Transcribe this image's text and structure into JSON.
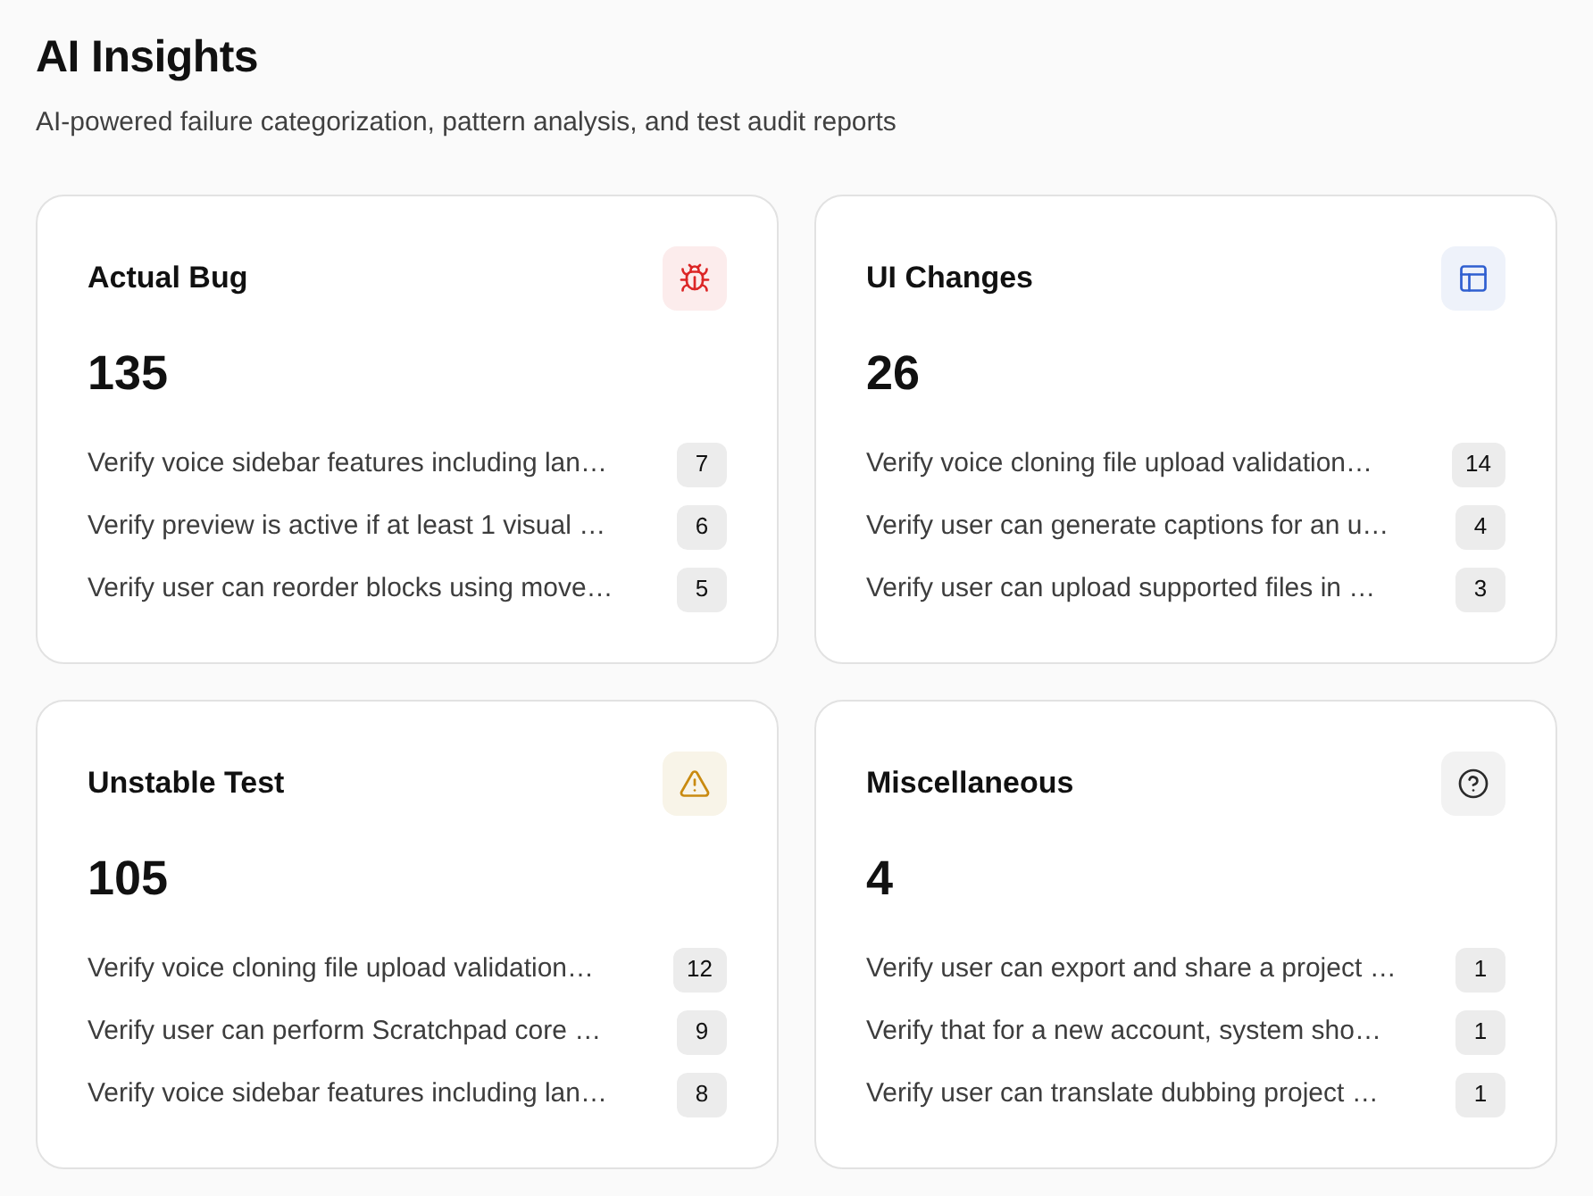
{
  "page": {
    "title": "AI Insights",
    "subtitle": "AI-powered failure categorization, pattern analysis, and test audit reports"
  },
  "categories": [
    {
      "kind": "bug",
      "title": "Actual Bug",
      "count": "135",
      "tests": [
        {
          "name": "Verify voice sidebar features including lan…",
          "count": "7"
        },
        {
          "name": "Verify preview is active if at least 1 visual …",
          "count": "6"
        },
        {
          "name": "Verify user can reorder blocks using move…",
          "count": "5"
        }
      ]
    },
    {
      "kind": "layout",
      "title": "UI Changes",
      "count": "26",
      "tests": [
        {
          "name": "Verify voice cloning file upload validation…",
          "count": "14"
        },
        {
          "name": "Verify user can generate captions for an u…",
          "count": "4"
        },
        {
          "name": "Verify user can upload supported files in …",
          "count": "3"
        }
      ]
    },
    {
      "kind": "warning",
      "title": "Unstable Test",
      "count": "105",
      "tests": [
        {
          "name": "Verify voice cloning file upload validation…",
          "count": "12"
        },
        {
          "name": "Verify user can perform Scratchpad core …",
          "count": "9"
        },
        {
          "name": "Verify voice sidebar features including lan…",
          "count": "8"
        }
      ]
    },
    {
      "kind": "help",
      "title": "Miscellaneous",
      "count": "4",
      "tests": [
        {
          "name": "Verify user can export and share a project …",
          "count": "1"
        },
        {
          "name": "Verify that for a new account, system sho…",
          "count": "1"
        },
        {
          "name": "Verify user can translate dubbing project …",
          "count": "1"
        }
      ]
    }
  ]
}
